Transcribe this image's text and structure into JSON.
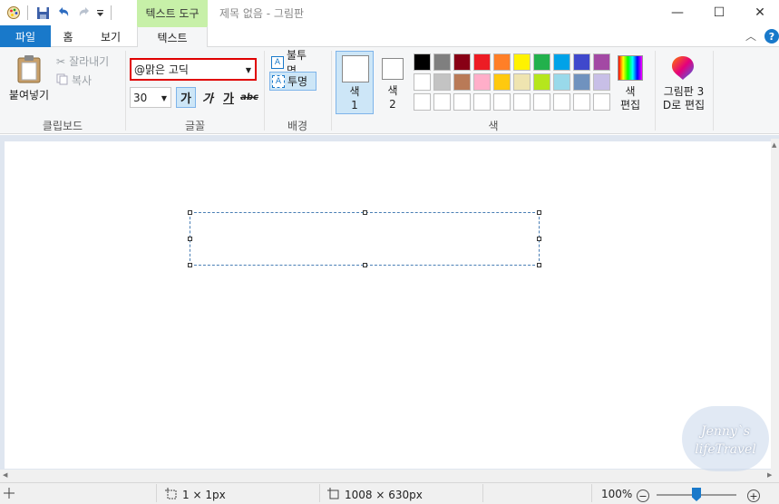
{
  "window": {
    "title": "제목 없음 - 그림판",
    "context_tab": "텍스트 도구",
    "minimize": "—",
    "maximize": "☐",
    "close": "✕"
  },
  "tabs": {
    "file": "파일",
    "home": "홈",
    "view": "보기",
    "text": "텍스트"
  },
  "help": "?",
  "clipboard": {
    "paste": "붙여넣기",
    "cut": "잘라내기",
    "copy": "복사",
    "group_label": "클립보드"
  },
  "font": {
    "family": "@맑은 고딕",
    "size": "30",
    "bold": "가",
    "italic": "가",
    "underline": "가",
    "strike": "abc",
    "group_label": "글꼴"
  },
  "background": {
    "opaque": "불투명",
    "transparent": "투명",
    "group_label": "배경"
  },
  "colors": {
    "color1_label_a": "색",
    "color1_label_b": "1",
    "color2_label_a": "색",
    "color2_label_b": "2",
    "edit_label_a": "색",
    "edit_label_b": "편집",
    "group_label": "색",
    "palette_row1": [
      "#000000",
      "#7f7f7f",
      "#880015",
      "#ed1c24",
      "#ff7f27",
      "#fff200",
      "#22b14c",
      "#00a2e8",
      "#3f48cc",
      "#a349a4"
    ],
    "palette_row2": [
      "#ffffff",
      "#c3c3c3",
      "#b97a57",
      "#ffaec9",
      "#ffc90e",
      "#efe4b0",
      "#b5e61d",
      "#99d9ea",
      "#7092be",
      "#c8bfe7"
    ],
    "palette_row3": [
      "#ffffff",
      "#ffffff",
      "#ffffff",
      "#ffffff",
      "#ffffff",
      "#ffffff",
      "#ffffff",
      "#ffffff",
      "#ffffff",
      "#ffffff"
    ]
  },
  "paint3d": {
    "label_a": "그림판 3",
    "label_b": "D로 편집"
  },
  "status": {
    "selection_size": "1 × 1px",
    "image_size": "1008 × 630px",
    "zoom": "100%",
    "zoom_level": 1.0
  },
  "watermark": {
    "line1": "Jenny`s",
    "line2": "lifeTravel"
  }
}
